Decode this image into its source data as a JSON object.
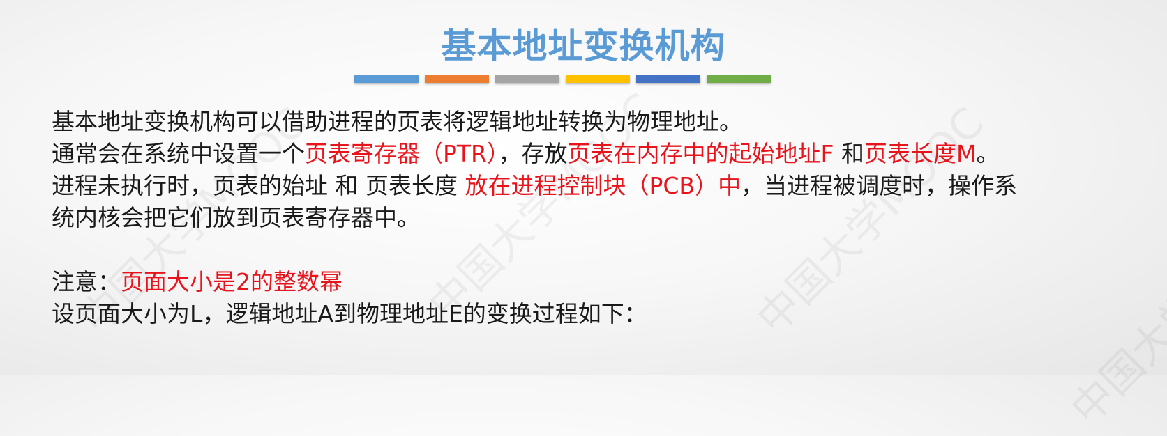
{
  "title": "基本地址变换机构",
  "accent_bars": [
    "#5b9bd5",
    "#ed7d31",
    "#a5a5a5",
    "#ffc000",
    "#4472c4",
    "#70ad47"
  ],
  "text_color": "#1a1a1a",
  "highlight_color": "#e8141c",
  "watermark": "中国大学MOOC",
  "paragraphs": {
    "p1": "基本地址变换机构可以借助进程的页表将逻辑地址转换为物理地址。",
    "p2": {
      "s1": "通常会在系统中设置一个",
      "s2": "页表寄存器（PTR）",
      "s3": "，存放",
      "s4": "页表在内存中的起始地址F",
      "s5": " 和",
      "s6": "页表长度M",
      "s7": "。"
    },
    "p3": {
      "s1": "进程未执行时，页表的始址 和 页表长度 ",
      "s2": "放在进程控制块（PCB）中",
      "s3": "，当进程被调度时，操作系"
    },
    "p4": "统内核会把它们放到页表寄存器中。",
    "p5": {
      "s1": "注意：",
      "s2": "页面大小是2的整数幂"
    },
    "p6": "设页面大小为L，逻辑地址A到物理地址E的变换过程如下："
  }
}
